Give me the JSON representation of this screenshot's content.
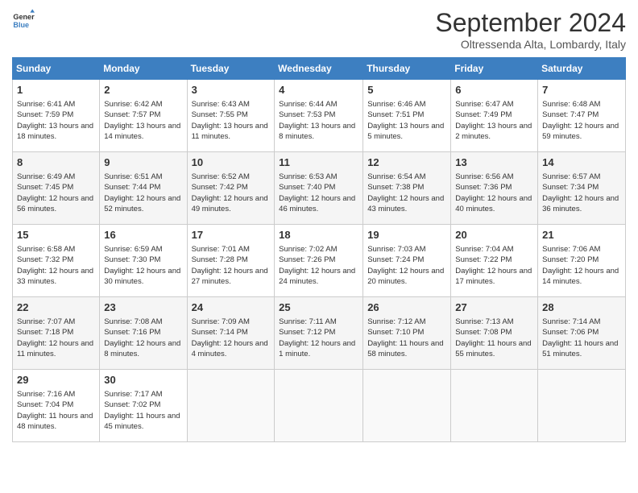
{
  "header": {
    "logo_line1": "General",
    "logo_line2": "Blue",
    "month": "September 2024",
    "location": "Oltressenda Alta, Lombardy, Italy"
  },
  "weekdays": [
    "Sunday",
    "Monday",
    "Tuesday",
    "Wednesday",
    "Thursday",
    "Friday",
    "Saturday"
  ],
  "weeks": [
    [
      {
        "day": "1",
        "sun": "Sunrise: 6:41 AM",
        "set": "Sunset: 7:59 PM",
        "day_text": "Daylight: 13 hours and 18 minutes."
      },
      {
        "day": "2",
        "sun": "Sunrise: 6:42 AM",
        "set": "Sunset: 7:57 PM",
        "day_text": "Daylight: 13 hours and 14 minutes."
      },
      {
        "day": "3",
        "sun": "Sunrise: 6:43 AM",
        "set": "Sunset: 7:55 PM",
        "day_text": "Daylight: 13 hours and 11 minutes."
      },
      {
        "day": "4",
        "sun": "Sunrise: 6:44 AM",
        "set": "Sunset: 7:53 PM",
        "day_text": "Daylight: 13 hours and 8 minutes."
      },
      {
        "day": "5",
        "sun": "Sunrise: 6:46 AM",
        "set": "Sunset: 7:51 PM",
        "day_text": "Daylight: 13 hours and 5 minutes."
      },
      {
        "day": "6",
        "sun": "Sunrise: 6:47 AM",
        "set": "Sunset: 7:49 PM",
        "day_text": "Daylight: 13 hours and 2 minutes."
      },
      {
        "day": "7",
        "sun": "Sunrise: 6:48 AM",
        "set": "Sunset: 7:47 PM",
        "day_text": "Daylight: 12 hours and 59 minutes."
      }
    ],
    [
      {
        "day": "8",
        "sun": "Sunrise: 6:49 AM",
        "set": "Sunset: 7:45 PM",
        "day_text": "Daylight: 12 hours and 56 minutes."
      },
      {
        "day": "9",
        "sun": "Sunrise: 6:51 AM",
        "set": "Sunset: 7:44 PM",
        "day_text": "Daylight: 12 hours and 52 minutes."
      },
      {
        "day": "10",
        "sun": "Sunrise: 6:52 AM",
        "set": "Sunset: 7:42 PM",
        "day_text": "Daylight: 12 hours and 49 minutes."
      },
      {
        "day": "11",
        "sun": "Sunrise: 6:53 AM",
        "set": "Sunset: 7:40 PM",
        "day_text": "Daylight: 12 hours and 46 minutes."
      },
      {
        "day": "12",
        "sun": "Sunrise: 6:54 AM",
        "set": "Sunset: 7:38 PM",
        "day_text": "Daylight: 12 hours and 43 minutes."
      },
      {
        "day": "13",
        "sun": "Sunrise: 6:56 AM",
        "set": "Sunset: 7:36 PM",
        "day_text": "Daylight: 12 hours and 40 minutes."
      },
      {
        "day": "14",
        "sun": "Sunrise: 6:57 AM",
        "set": "Sunset: 7:34 PM",
        "day_text": "Daylight: 12 hours and 36 minutes."
      }
    ],
    [
      {
        "day": "15",
        "sun": "Sunrise: 6:58 AM",
        "set": "Sunset: 7:32 PM",
        "day_text": "Daylight: 12 hours and 33 minutes."
      },
      {
        "day": "16",
        "sun": "Sunrise: 6:59 AM",
        "set": "Sunset: 7:30 PM",
        "day_text": "Daylight: 12 hours and 30 minutes."
      },
      {
        "day": "17",
        "sun": "Sunrise: 7:01 AM",
        "set": "Sunset: 7:28 PM",
        "day_text": "Daylight: 12 hours and 27 minutes."
      },
      {
        "day": "18",
        "sun": "Sunrise: 7:02 AM",
        "set": "Sunset: 7:26 PM",
        "day_text": "Daylight: 12 hours and 24 minutes."
      },
      {
        "day": "19",
        "sun": "Sunrise: 7:03 AM",
        "set": "Sunset: 7:24 PM",
        "day_text": "Daylight: 12 hours and 20 minutes."
      },
      {
        "day": "20",
        "sun": "Sunrise: 7:04 AM",
        "set": "Sunset: 7:22 PM",
        "day_text": "Daylight: 12 hours and 17 minutes."
      },
      {
        "day": "21",
        "sun": "Sunrise: 7:06 AM",
        "set": "Sunset: 7:20 PM",
        "day_text": "Daylight: 12 hours and 14 minutes."
      }
    ],
    [
      {
        "day": "22",
        "sun": "Sunrise: 7:07 AM",
        "set": "Sunset: 7:18 PM",
        "day_text": "Daylight: 12 hours and 11 minutes."
      },
      {
        "day": "23",
        "sun": "Sunrise: 7:08 AM",
        "set": "Sunset: 7:16 PM",
        "day_text": "Daylight: 12 hours and 8 minutes."
      },
      {
        "day": "24",
        "sun": "Sunrise: 7:09 AM",
        "set": "Sunset: 7:14 PM",
        "day_text": "Daylight: 12 hours and 4 minutes."
      },
      {
        "day": "25",
        "sun": "Sunrise: 7:11 AM",
        "set": "Sunset: 7:12 PM",
        "day_text": "Daylight: 12 hours and 1 minute."
      },
      {
        "day": "26",
        "sun": "Sunrise: 7:12 AM",
        "set": "Sunset: 7:10 PM",
        "day_text": "Daylight: 11 hours and 58 minutes."
      },
      {
        "day": "27",
        "sun": "Sunrise: 7:13 AM",
        "set": "Sunset: 7:08 PM",
        "day_text": "Daylight: 11 hours and 55 minutes."
      },
      {
        "day": "28",
        "sun": "Sunrise: 7:14 AM",
        "set": "Sunset: 7:06 PM",
        "day_text": "Daylight: 11 hours and 51 minutes."
      }
    ],
    [
      {
        "day": "29",
        "sun": "Sunrise: 7:16 AM",
        "set": "Sunset: 7:04 PM",
        "day_text": "Daylight: 11 hours and 48 minutes."
      },
      {
        "day": "30",
        "sun": "Sunrise: 7:17 AM",
        "set": "Sunset: 7:02 PM",
        "day_text": "Daylight: 11 hours and 45 minutes."
      },
      null,
      null,
      null,
      null,
      null
    ]
  ]
}
